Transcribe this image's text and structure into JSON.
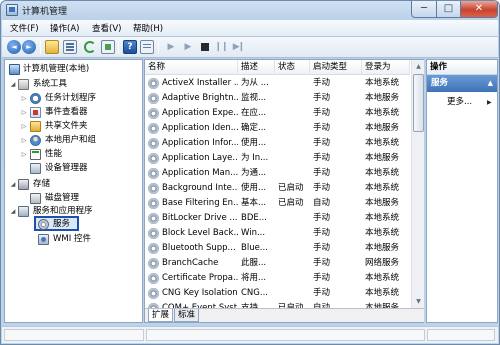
{
  "window": {
    "title": "计算机管理",
    "minimize": "─",
    "maximize": "□",
    "close": "✕"
  },
  "menubar": [
    "文件(F)",
    "操作(A)",
    "查看(V)",
    "帮助(H)"
  ],
  "toolbar": {
    "play": "▶",
    "play2": "▶",
    "pause": "❙❙",
    "restart": "▶❙"
  },
  "tree": [
    {
      "label": "计算机管理(本地)",
      "icon": "computer-icon"
    },
    {
      "label": "系统工具",
      "icon": "tools-icon",
      "expander": "◢"
    },
    {
      "label": "任务计划程序",
      "icon": "task-scheduler-icon",
      "expander": "▷"
    },
    {
      "label": "事件查看器",
      "icon": "event-viewer-icon",
      "expander": "▷"
    },
    {
      "label": "共享文件夹",
      "icon": "shared-folder-icon",
      "expander": "▷"
    },
    {
      "label": "本地用户和组",
      "icon": "users-icon",
      "expander": "▷"
    },
    {
      "label": "性能",
      "icon": "performance-icon",
      "expander": "▷"
    },
    {
      "label": "设备管理器",
      "icon": "device-manager-icon"
    },
    {
      "label": "存储",
      "icon": "storage-icon",
      "expander": "◢"
    },
    {
      "label": "磁盘管理",
      "icon": "disk-icon"
    },
    {
      "label": "服务和应用程序",
      "icon": "services-apps-icon",
      "expander": "◢"
    },
    {
      "label": "服务",
      "icon": "gear-icon",
      "selected": true
    },
    {
      "label": "WMI 控件",
      "icon": "wmi-icon"
    }
  ],
  "list": {
    "columns": [
      "名称",
      "描述",
      "状态",
      "启动类型",
      "登录为"
    ],
    "rows": [
      [
        "ActiveX Installer ...",
        "为从 ...",
        "",
        "手动",
        "本地系统"
      ],
      [
        "Adaptive Brightn...",
        "监视...",
        "",
        "手动",
        "本地服务"
      ],
      [
        "Application Expe...",
        "在应...",
        "",
        "手动",
        "本地系统"
      ],
      [
        "Application Iden...",
        "确定...",
        "",
        "手动",
        "本地服务"
      ],
      [
        "Application Infor...",
        "使用...",
        "",
        "手动",
        "本地系统"
      ],
      [
        "Application Laye...",
        "为 In...",
        "",
        "手动",
        "本地服务"
      ],
      [
        "Application Man...",
        "为通...",
        "",
        "手动",
        "本地系统"
      ],
      [
        "Background Inte...",
        "使用...",
        "已启动",
        "手动",
        "本地系统"
      ],
      [
        "Base Filtering En...",
        "基本...",
        "已启动",
        "自动",
        "本地服务"
      ],
      [
        "BitLocker Drive ...",
        "BDE...",
        "",
        "手动",
        "本地系统"
      ],
      [
        "Block Level Back...",
        "Win...",
        "",
        "手动",
        "本地系统"
      ],
      [
        "Bluetooth Supp...",
        "Blue...",
        "",
        "手动",
        "本地服务"
      ],
      [
        "BranchCache",
        "此服...",
        "",
        "手动",
        "网络服务"
      ],
      [
        "Certificate Propa...",
        "将用...",
        "",
        "手动",
        "本地系统"
      ],
      [
        "CNG Key Isolation",
        "CNG...",
        "",
        "手动",
        "本地系统"
      ],
      [
        "COM+ Event Syst...",
        "支持...",
        "已启动",
        "自动",
        "本地服务"
      ]
    ],
    "scroll_up": "▲",
    "scroll_down": "▼",
    "tabs": [
      "扩展",
      "标准"
    ]
  },
  "actions": {
    "header": "操作",
    "section": "服务",
    "section_arrow": "▲",
    "more": "更多...",
    "more_arrow": "▶"
  }
}
